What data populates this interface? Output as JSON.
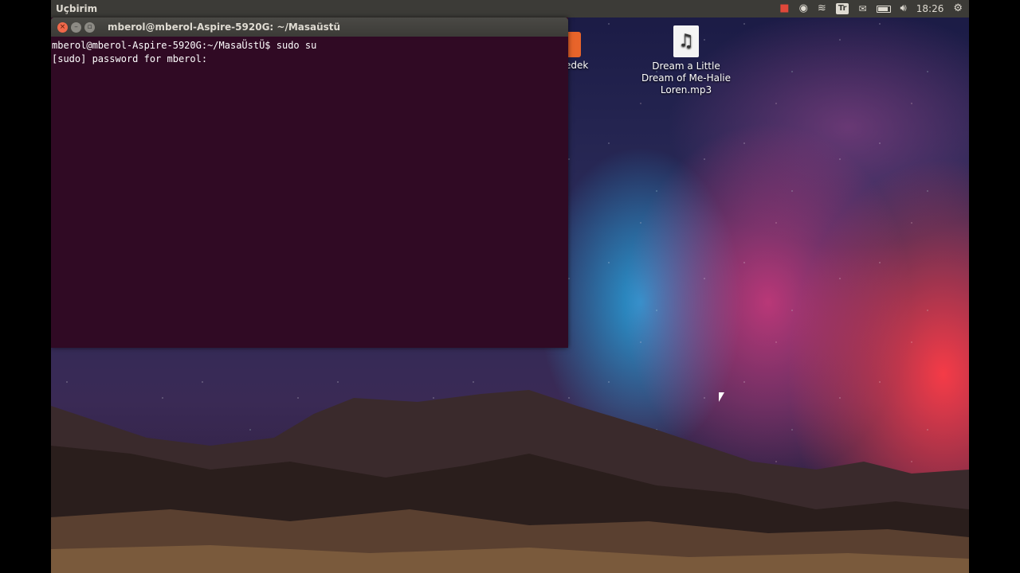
{
  "topbar": {
    "app_name": "Uçbirim",
    "clock": "18:26",
    "keyboard_layout": "Tr",
    "icons": [
      "record-icon",
      "chrome-icon",
      "wifi-icon",
      "keyboard-icon",
      "mail-icon",
      "battery-icon",
      "volume-icon",
      "gear-icon"
    ]
  },
  "terminal": {
    "title": "mberol@mberol-Aspire-5920G: ~/Masaüstü",
    "lines": [
      "mberol@mberol-Aspire-5920G:~/MasaÜstÜ$ sudo su",
      "[sudo] password for mberol:"
    ],
    "colors": {
      "background": "#300a24",
      "text": "#ffffff"
    }
  },
  "desktop": {
    "partial_icon_label": "edek",
    "music_file": {
      "line1": "Dream a Little",
      "line2": "Dream of Me-Halie",
      "line3": "Loren.mp3",
      "icon": "music-file-icon"
    }
  }
}
